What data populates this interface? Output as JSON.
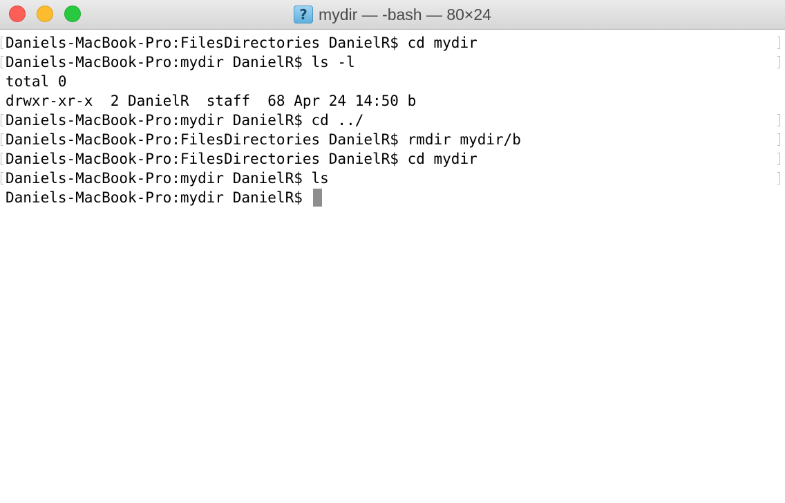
{
  "window": {
    "title": "mydir — -bash — 80×24",
    "proxy_icon": "question-document-icon",
    "proxy_glyph": "?",
    "colors": {
      "close": "#fc5f57",
      "minimize": "#fdbc2e",
      "zoom": "#28c840",
      "cursor": "#8e8e8e"
    }
  },
  "terminal": {
    "lines": [
      {
        "text": "Daniels-MacBook-Pro:FilesDirectories DanielR$ cd mydir",
        "marked": true
      },
      {
        "text": "Daniels-MacBook-Pro:mydir DanielR$ ls -l",
        "marked": true
      },
      {
        "text": "total 0",
        "marked": false
      },
      {
        "text": "drwxr-xr-x  2 DanielR  staff  68 Apr 24 14:50 b",
        "marked": false
      },
      {
        "text": "Daniels-MacBook-Pro:mydir DanielR$ cd ../",
        "marked": true
      },
      {
        "text": "Daniels-MacBook-Pro:FilesDirectories DanielR$ rmdir mydir/b",
        "marked": true
      },
      {
        "text": "Daniels-MacBook-Pro:FilesDirectories DanielR$ cd mydir",
        "marked": true
      },
      {
        "text": "Daniels-MacBook-Pro:mydir DanielR$ ls",
        "marked": true
      },
      {
        "text": "Daniels-MacBook-Pro:mydir DanielR$ ",
        "marked": false,
        "cursor": true
      }
    ]
  }
}
